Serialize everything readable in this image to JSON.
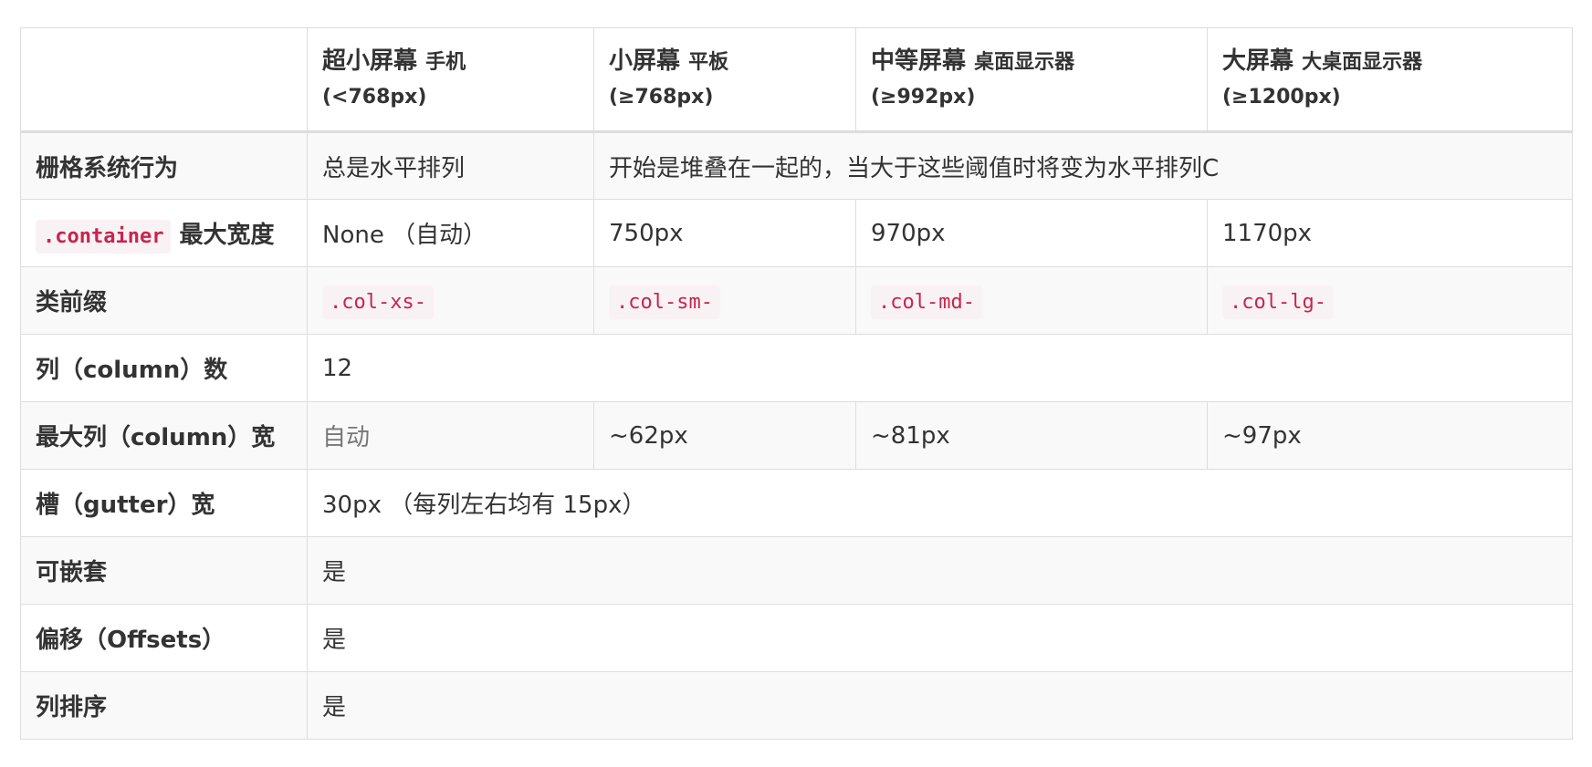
{
  "header": [
    {
      "main": "",
      "sub": "",
      "range": ""
    },
    {
      "main": "超小屏幕",
      "sub": "手机",
      "range": "(<768px)"
    },
    {
      "main": "小屏幕",
      "sub": "平板",
      "range": "(≥768px)"
    },
    {
      "main": "中等屏幕",
      "sub": "桌面显示器",
      "range": "(≥992px)"
    },
    {
      "main": "大屏幕",
      "sub": "大桌面显示器",
      "range": "(≥1200px)"
    }
  ],
  "rows": {
    "grid_behavior": {
      "label": "栅格系统行为",
      "xs": "总是水平排列",
      "rest": "开始是堆叠在一起的，当大于这些阈值时将变为水平排列C"
    },
    "container_width": {
      "label_code": ".container",
      "label_text": "最大宽度",
      "xs": "None （自动）",
      "sm": "750px",
      "md": "970px",
      "lg": "1170px"
    },
    "class_prefix": {
      "label": "类前缀",
      "xs": ".col-xs-",
      "sm": ".col-sm-",
      "md": ".col-md-",
      "lg": ".col-lg-"
    },
    "columns": {
      "label": "列（column）数",
      "value": "12"
    },
    "max_column_width": {
      "label": "最大列（column）宽",
      "xs": "自动",
      "sm": "~62px",
      "md": "~81px",
      "lg": "~97px"
    },
    "gutter": {
      "label": "槽（gutter）宽",
      "value": "30px （每列左右均有 15px）"
    },
    "nestable": {
      "label": "可嵌套",
      "value": "是"
    },
    "offsets": {
      "label": "偏移（Offsets）",
      "value": "是"
    },
    "ordering": {
      "label": "列排序",
      "value": "是"
    }
  }
}
